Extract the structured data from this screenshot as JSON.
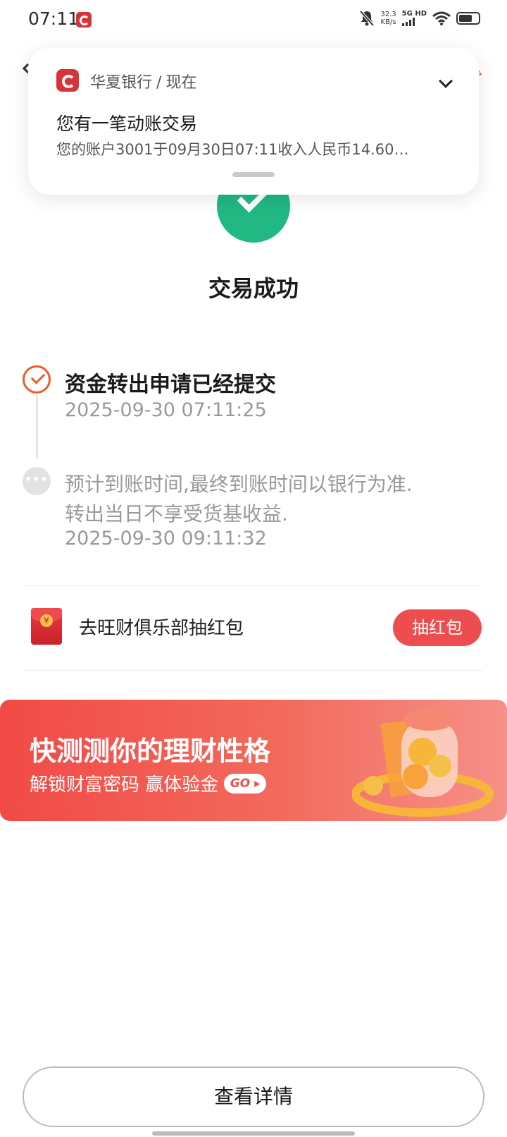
{
  "status_bar": {
    "time": "07:11",
    "net_speed_value": "32.3",
    "net_speed_unit": "KB/s",
    "network": "5G HD",
    "icons": [
      "app-notification-icon",
      "mute-icon",
      "signal-icon",
      "wifi-icon",
      "battery-icon"
    ],
    "battery_level": 0.7
  },
  "notification": {
    "app_name": "华夏银行",
    "separator": "/",
    "time": "现在",
    "title": "您有一笔动账交易",
    "body": "您的账户3001于09月30日07:11收入人民币14.60…",
    "icons": [
      "hua-xia-bank-logo-icon",
      "chevron-down-icon"
    ]
  },
  "result": {
    "title": "交易成功",
    "icon": "success-check-icon",
    "color": "#21b884"
  },
  "timeline": {
    "step1": {
      "title": "资金转出申请已经提交",
      "time": "2025-09-30 07:11:25",
      "icon": "check-circle-icon",
      "color": "#ee5b2c"
    },
    "step2": {
      "desc_line1": "预计到账时间,最终到账时间以银行为准.",
      "desc_line2": "转出当日不享受货基收益.",
      "time": "2025-09-30 09:11:32",
      "icon": "pending-dots-icon"
    }
  },
  "red_packet": {
    "label": "去旺财俱乐部抽红包",
    "button": "抽红包",
    "icon": "red-envelope-icon",
    "color": "#ee4d4f"
  },
  "banner": {
    "title": "快测测你的理财性格",
    "subtitle": "解锁财富密码 赢体验金",
    "go": "GO",
    "icon": "gold-coin-jar-illustration"
  },
  "footer": {
    "detail_button": "查看详情"
  }
}
